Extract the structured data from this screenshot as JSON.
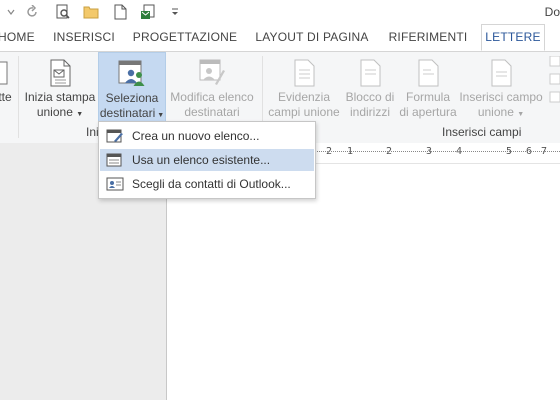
{
  "qat": {
    "user_label": "Do"
  },
  "tabs": [
    {
      "label": "HOME"
    },
    {
      "label": "INSERISCI"
    },
    {
      "label": "PROGETTAZIONE"
    },
    {
      "label": "LAYOUT DI PAGINA"
    },
    {
      "label": "RIFERIMENTI"
    },
    {
      "label": "LETTERE",
      "active": true
    }
  ],
  "ribbon": {
    "partial_left_label": "tte",
    "buttons": [
      {
        "line1": "Inizia stampa",
        "line2": "unione"
      },
      {
        "line1": "Seleziona",
        "line2": "destinatari"
      },
      {
        "line1": "Modifica elenco",
        "line2": "destinatari"
      },
      {
        "line1": "Evidenzia",
        "line2": "campi unione"
      },
      {
        "line1": "Blocco di",
        "line2": "indirizzi"
      },
      {
        "line1": "Formula",
        "line2": "di apertura"
      },
      {
        "line1": "Inserisci campo",
        "line2": "unione"
      }
    ],
    "group_labels": {
      "start_partial": "Ini",
      "insert_fields": "Inserisci campi"
    }
  },
  "ruler": {
    "ticks": [
      "2",
      "1",
      "2",
      "3",
      "4",
      "5",
      "6",
      "7"
    ]
  },
  "menu": {
    "items": [
      {
        "label": "Crea un nuovo elenco...",
        "icon": "new-list-icon"
      },
      {
        "label": "Usa un elenco esistente...",
        "icon": "existing-list-icon",
        "hover": true
      },
      {
        "label": "Scegli da contatti di Outlook...",
        "icon": "outlook-contacts-icon"
      }
    ]
  },
  "colors": {
    "accent": "#2b579a",
    "pressed": "#c5d9f1",
    "menu_hover": "#cddcef"
  }
}
